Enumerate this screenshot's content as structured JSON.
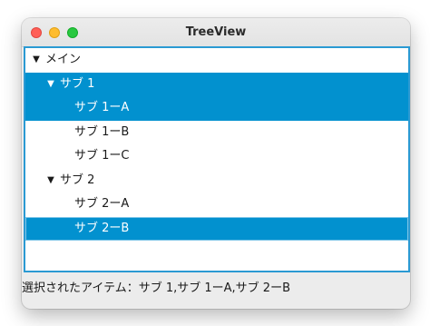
{
  "window": {
    "title": "TreeView"
  },
  "tree": {
    "items": [
      {
        "label": "メイン",
        "level": 0,
        "expanded": true,
        "selected": false,
        "focused": false
      },
      {
        "label": "サブ 1",
        "level": 1,
        "expanded": true,
        "selected": true,
        "focused": false
      },
      {
        "label": "サブ 1ーA",
        "level": 2,
        "selected": true,
        "focused": false
      },
      {
        "label": "サブ 1ーB",
        "level": 2,
        "selected": false,
        "focused": false
      },
      {
        "label": "サブ 1ーC",
        "level": 2,
        "selected": false,
        "focused": false
      },
      {
        "label": "サブ 2",
        "level": 1,
        "expanded": true,
        "selected": false,
        "focused": false
      },
      {
        "label": "サブ 2ーA",
        "level": 2,
        "selected": false,
        "focused": false
      },
      {
        "label": "サブ 2ーB",
        "level": 2,
        "selected": true,
        "focused": true
      }
    ],
    "expanded_icon": "▼"
  },
  "status": {
    "text": "選択されたアイテム：サブ 1,サブ 1ーA,サブ 2ーB"
  },
  "colors": {
    "selection": "#0291cf",
    "focus_border": "#2b9ad3",
    "close": "#ff5f57",
    "minimize": "#febc2e",
    "zoom": "#28c840"
  }
}
